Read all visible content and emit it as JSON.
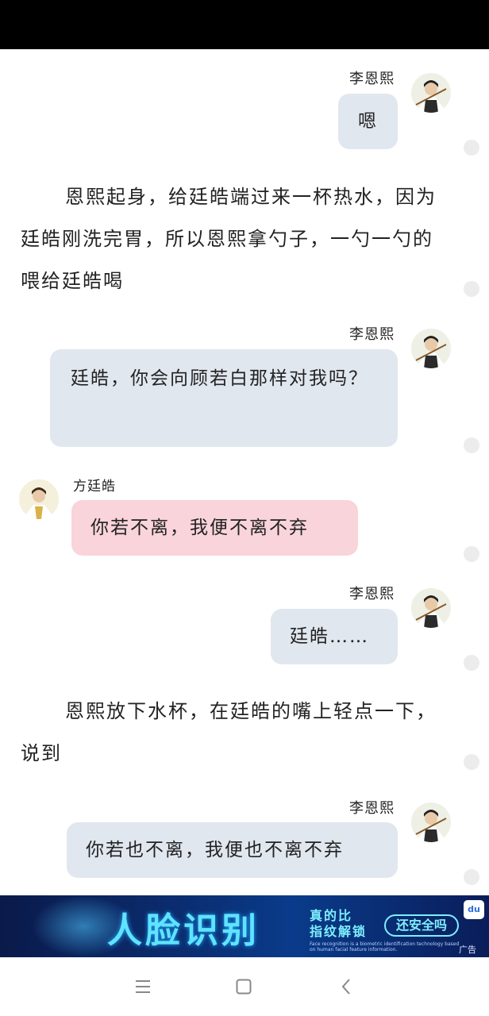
{
  "chat": {
    "messages": [
      {
        "sender": "李恩熙",
        "text": "嗯"
      },
      {
        "narration": "恩熙起身，给廷皓端过来一杯热水，因为廷皓刚洗完胃，所以恩熙拿勺子，一勺一勺的喂给廷皓喝"
      },
      {
        "sender": "李恩熙",
        "text": "廷皓，你会向顾若白那样对我吗？"
      },
      {
        "sender": "方廷皓",
        "text": "你若不离，我便不离不弃"
      },
      {
        "sender": "李恩熙",
        "text": "廷皓……"
      },
      {
        "narration": "恩熙放下水杯，在廷皓的嘴上轻点一下，说到"
      },
      {
        "sender": "李恩熙",
        "text": "你若也不离，我便也不离不弃"
      }
    ]
  },
  "ad": {
    "title": "人脸识别",
    "sub1": "真的比",
    "sub2": "指纹解锁",
    "button": "还安全吗",
    "fine_print": "Face recognition is a biometric identification technology based on human facial feature information.",
    "logo": "du",
    "label": "广告"
  },
  "colors": {
    "right_bubble": "#e1e7ef",
    "left_bubble": "#f9d4da"
  },
  "icons": {
    "nav_menu": "menu-icon",
    "nav_home": "home-square-icon",
    "nav_back": "back-chevron-icon"
  }
}
